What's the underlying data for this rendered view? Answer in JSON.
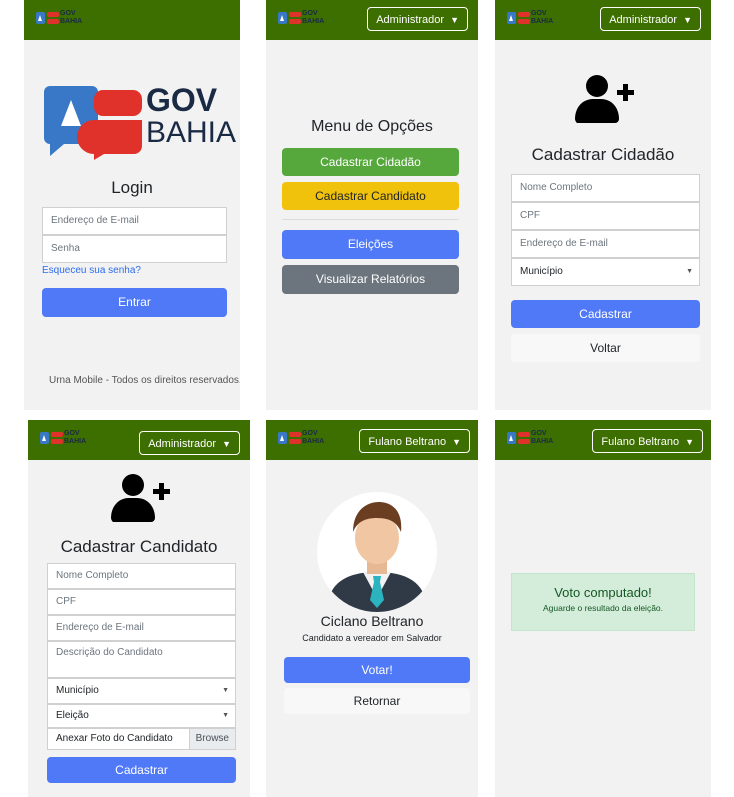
{
  "login": {
    "logo_gov": "GOV",
    "logo_bahia": "BAHIA",
    "title": "Login",
    "email_placeholder": "Endereço de E-mail",
    "password_placeholder": "Senha",
    "forgot_link": "Esqueceu sua senha?",
    "submit_label": "Entrar",
    "footer": "Urna Mobile - Todos os direitos reservados."
  },
  "navbar": {
    "logo_gov": "GOV",
    "logo_bahia": "BAHIA",
    "admin_user": "Administrador",
    "voter_user": "Fulano Beltrano"
  },
  "menu": {
    "title": "Menu de Opções",
    "items": [
      "Cadastrar Cidadão",
      "Cadastrar Candidato",
      "Eleições",
      "Visualizar Relatórios"
    ]
  },
  "cadastrar_cidadao": {
    "title": "Cadastrar Cidadão",
    "name_placeholder": "Nome Completo",
    "cpf_placeholder": "CPF",
    "email_placeholder": "Endereço de E-mail",
    "municipio": "Município",
    "submit_label": "Cadastrar",
    "back_label": "Voltar"
  },
  "cadastrar_candidato": {
    "title": "Cadastrar Candidato",
    "name_placeholder": "Nome Completo",
    "cpf_placeholder": "CPF",
    "email_placeholder": "Endereço de E-mail",
    "description_placeholder": "Descrição do Candidato",
    "municipio": "Município",
    "eleicao": "Eleição",
    "photo_label": "Anexar Foto do Candidato",
    "browse_label": "Browse",
    "submit_label": "Cadastrar"
  },
  "votar": {
    "candidate_name": "Ciclano Beltrano",
    "candidate_role": "Candidato a vereador em Salvador",
    "vote_label": "Votar!",
    "back_label": "Retornar"
  },
  "voto": {
    "title": "Voto computado!",
    "message": "Aguarde o resultado da eleição."
  },
  "colors": {
    "navbar": "#3d6e00",
    "primary": "#5079f7",
    "success": "#56a83c",
    "warning": "#f0c20b",
    "secondary": "#6c757d",
    "alert_bg": "#d4edda"
  }
}
